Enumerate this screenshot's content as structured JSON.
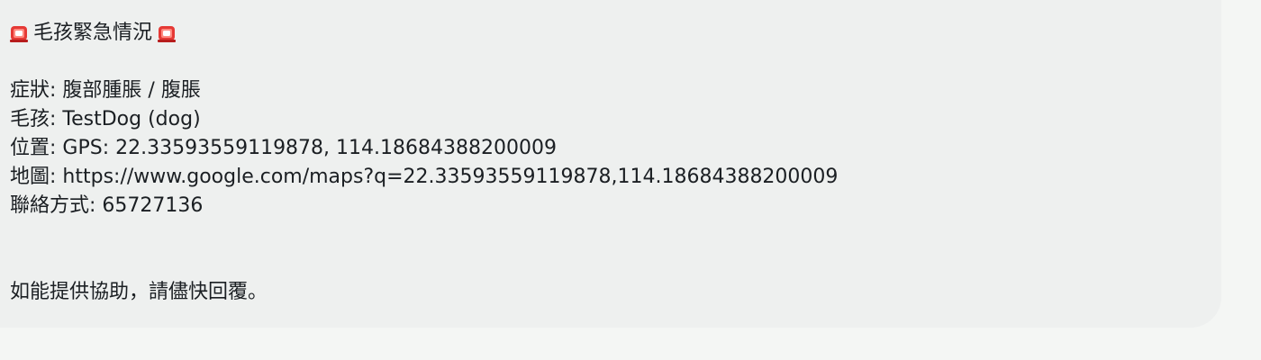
{
  "message": {
    "title": "毛孩緊急情況",
    "icons": {
      "left": "siren-icon",
      "right": "siren-icon"
    },
    "lines": [
      {
        "label": "症狀",
        "value": "腹部腫脹 / 腹脹"
      },
      {
        "label": "毛孩",
        "value": "TestDog (dog)"
      },
      {
        "label": "位置",
        "value": "GPS: 22.33593559119878, 114.18684388200009"
      },
      {
        "label": "地圖",
        "value": "https://www.google.com/maps?q=22.33593559119878,114.18684388200009"
      },
      {
        "label": "聯絡方式",
        "value": "65727136"
      }
    ],
    "closing": "如能提供協助，請儘快回覆。"
  },
  "colors": {
    "page_background": "#f4f6f4",
    "bubble_background": "#eef0ef",
    "text": "#1b1f23",
    "siren_red": "#e53935"
  }
}
